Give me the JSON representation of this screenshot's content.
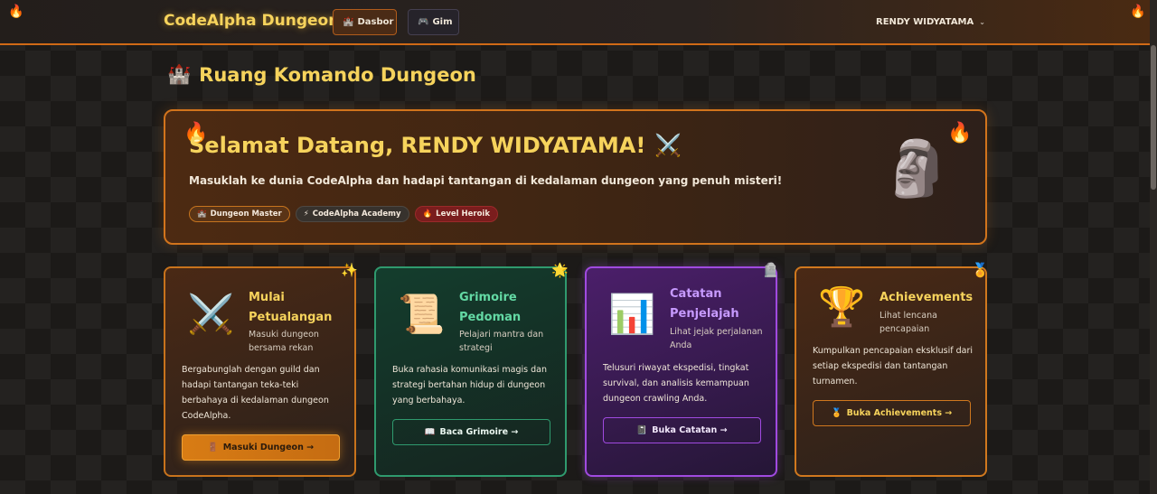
{
  "navbar": {
    "brand": "CodeAlpha Dungeon",
    "buttons": [
      {
        "icon": "🏰",
        "label": "Dasbor"
      },
      {
        "icon": "🎮",
        "label": "Gim"
      }
    ],
    "user": "RENDY WIDYATAMA",
    "user_chevron": "⌄",
    "flame_icon": "🔥"
  },
  "page": {
    "title_icon": "🏰",
    "title": "Ruang Komando Dungeon"
  },
  "hero": {
    "title": "Selamat Datang, RENDY WIDYATAMA!",
    "title_icon": "⚔️",
    "subtitle": "Masuklah ke dunia CodeAlpha dan hadapi tantangan di kedalaman dungeon yang penuh misteri!",
    "badges": [
      {
        "icon": "🏰",
        "label": "Dungeon Master"
      },
      {
        "icon": "⚡",
        "label": "CodeAlpha Academy"
      },
      {
        "icon": "🔥",
        "label": "Level Heroik"
      }
    ],
    "flame_icon": "🔥",
    "mascot_icon": "🗿"
  },
  "cards": [
    {
      "corner_icon": "✨",
      "icon": "⚔️",
      "title": "Mulai Petualangan",
      "description": "Masuki dungeon bersama rekan",
      "body": "Bergabunglah dengan guild dan hadapi tantangan teka-teki berbahaya di kedalaman dungeon CodeAlpha.",
      "button_icon": "🚪",
      "button": "Masuki Dungeon →"
    },
    {
      "corner_icon": "🌟",
      "icon": "📜",
      "title": "Grimoire Pedoman",
      "description": "Pelajari mantra dan strategi",
      "body": "Buka rahasia komunikasi magis dan strategi bertahan hidup di dungeon yang berbahaya.",
      "button_icon": "📖",
      "button": "Baca Grimoire →"
    },
    {
      "corner_icon": "🪦",
      "icon": "📊",
      "title": "Catatan Penjelajah",
      "description": "Lihat jejak perjalanan Anda",
      "body": "Telusuri riwayat ekspedisi, tingkat survival, dan analisis kemampuan dungeon crawling Anda.",
      "button_icon": "📓",
      "button": "Buka Catatan →"
    },
    {
      "corner_icon": "🏅",
      "icon": "🏆",
      "title": "Achievements",
      "description": "Lihat lencana pencapaian",
      "body": "Kumpulkan pencapaian eksklusif dari setiap ekspedisi dan tantangan turnamen.",
      "button_icon": "🏅",
      "button": "Buka Achievements →"
    }
  ]
}
